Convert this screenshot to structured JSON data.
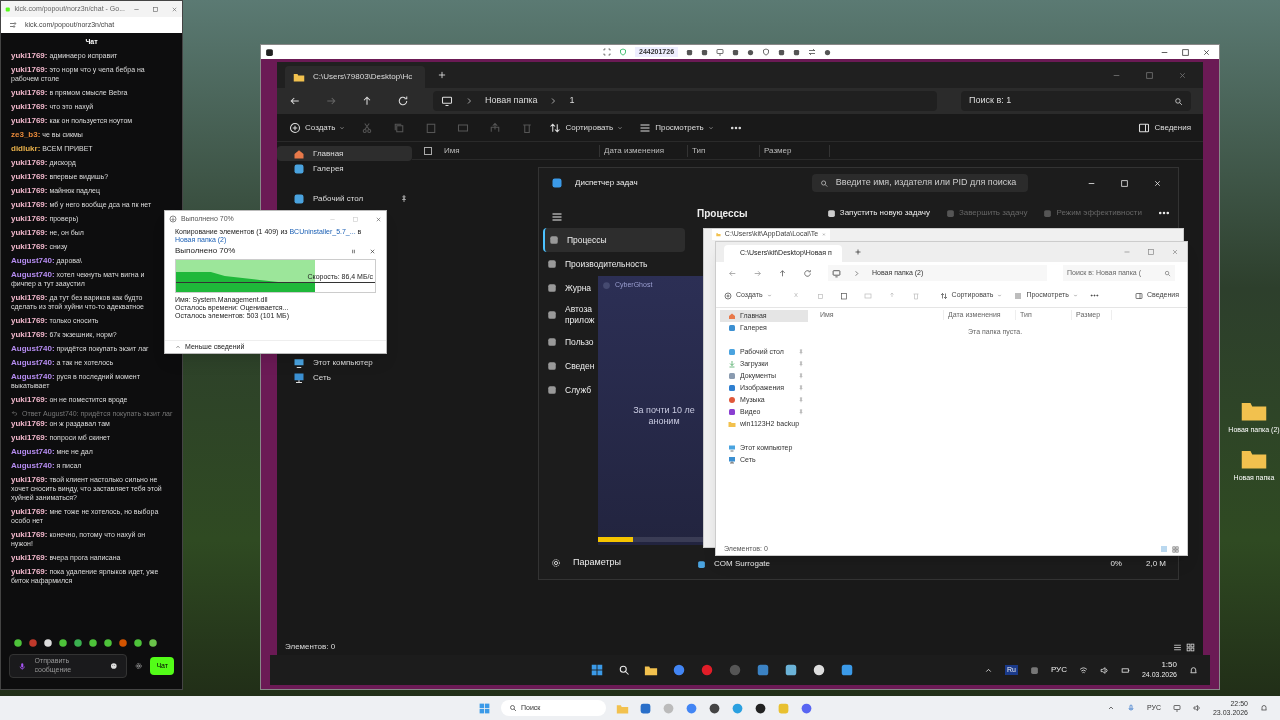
{
  "host_desktop": {
    "icons": [
      {
        "label": "Новая папка (2)"
      },
      {
        "label": "Новая папка"
      }
    ]
  },
  "chat_window": {
    "title": "kick.com/popout/norz3n/chat - Go...",
    "url": "kick.com/popout/norz3n/chat",
    "header": "Чат",
    "messages": [
      {
        "kind": "message",
        "user": "yuki1769:",
        "color": "#f2b8cc",
        "text": "админаеро исправит"
      },
      {
        "kind": "message",
        "user": "yuki1769:",
        "color": "#f2b8cc",
        "text": "это норм что у чела бебра на рабочем столе"
      },
      {
        "kind": "message",
        "user": "yuki1769:",
        "color": "#f2b8cc",
        "text": "в прямом смысле Bebra"
      },
      {
        "kind": "message",
        "user": "yuki1769:",
        "color": "#f2b8cc",
        "text": "что это нахуй"
      },
      {
        "kind": "message",
        "user": "yuki1769:",
        "color": "#f2b8cc",
        "text": "как он пользуется ноутом"
      },
      {
        "kind": "message",
        "user": "ze3_b3:",
        "color": "#e8893a",
        "text": "че вы сикмы"
      },
      {
        "kind": "message",
        "user": "didlukr:",
        "color": "#e8b04a",
        "text": "ВСЕМ ПРИВЕТ"
      },
      {
        "kind": "message",
        "user": "yuki1769:",
        "color": "#f2b8cc",
        "text": "дискорд"
      },
      {
        "kind": "message",
        "user": "yuki1769:",
        "color": "#f2b8cc",
        "text": "впервые видишь?"
      },
      {
        "kind": "message",
        "user": "yuki1769:",
        "color": "#f2b8cc",
        "text": "майнюк падлец"
      },
      {
        "kind": "message",
        "user": "yuki1769:",
        "color": "#f2b8cc",
        "text": "мб у него вообще дса на пк нет"
      },
      {
        "kind": "message",
        "user": "yuki1769:",
        "color": "#f2b8cc",
        "text": "проверь)"
      },
      {
        "kind": "message",
        "user": "yuki1769:",
        "color": "#f2b8cc",
        "text": "не, он был"
      },
      {
        "kind": "message",
        "user": "yuki1769:",
        "color": "#f2b8cc",
        "text": "снизу"
      },
      {
        "kind": "message",
        "user": "August740:",
        "color": "#b58cf0",
        "text": "дарова\\"
      },
      {
        "kind": "message",
        "user": "August740:",
        "color": "#b58cf0",
        "text": "хотел чекнуть матч вигна и фичпер а тут заaустил"
      },
      {
        "kind": "message",
        "user": "yuki1769:",
        "color": "#f2b8cc",
        "text": "да тут без вариков как будто сделать из этой хуйни что-то адекватное"
      },
      {
        "kind": "message",
        "user": "yuki1769:",
        "color": "#f2b8cc",
        "text": "только сносить"
      },
      {
        "kind": "message",
        "user": "yuki1769:",
        "color": "#f2b8cc",
        "text": "67к экзешник, норм?"
      },
      {
        "kind": "message",
        "user": "August740:",
        "color": "#b58cf0",
        "text": "придётся покупать экзит лаг"
      },
      {
        "kind": "message",
        "user": "August740:",
        "color": "#b58cf0",
        "text": "а так не хотелось"
      },
      {
        "kind": "message",
        "user": "August740:",
        "color": "#b58cf0",
        "text": "руся в последний момент выкатывает"
      },
      {
        "kind": "message",
        "user": "yuki1769:",
        "color": "#f2b8cc",
        "text": "он не поместится вроде"
      },
      {
        "kind": "reply",
        "text": "Ответ August740: придётся покупать экзит лаг"
      },
      {
        "kind": "message",
        "user": "yuki1769:",
        "color": "#f2b8cc",
        "text": "он ж раздавал там"
      },
      {
        "kind": "message",
        "user": "yuki1769:",
        "color": "#f2b8cc",
        "text": "попроси мб скинет"
      },
      {
        "kind": "message",
        "user": "August740:",
        "color": "#b58cf0",
        "text": "мне не дал"
      },
      {
        "kind": "message",
        "user": "August740:",
        "color": "#b58cf0",
        "text": "я писал"
      },
      {
        "kind": "message",
        "user": "yuki1769:",
        "color": "#f2b8cc",
        "text": "твой клиент настолько сильно не хочет сносить винду, что заставляет тебя этой хуйней заниматься?"
      },
      {
        "kind": "message",
        "user": "yuki1769:",
        "color": "#f2b8cc",
        "text": "мне тоже не хотелось, но выбора особо нет"
      },
      {
        "kind": "message",
        "user": "yuki1769:",
        "color": "#f2b8cc",
        "text": "конечно, потому что нахуй он нужон!"
      },
      {
        "kind": "message",
        "user": "yuki1769:",
        "color": "#f2b8cc",
        "text": "вчера прога написана"
      },
      {
        "kind": "message",
        "user": "yuki1769:",
        "color": "#f2b8cc",
        "text": "пока удаление ярлыков идет, уже биток нафармился"
      }
    ],
    "input": {
      "placeholder": "Отправить сообщение"
    },
    "send_button": "Чат"
  },
  "copy_dialog": {
    "title": "Выполнено 70%",
    "summary": "Копирование элементов (1 409) из",
    "source": "BCUninstaller_5.7_...",
    "joiner": "в",
    "destination": "Новая папка (2)",
    "heading": "Выполнено 70%",
    "level": 0.7,
    "speed": "Скорость: 86,4 МБ/с",
    "details": [
      {
        "label": "Имя:",
        "value": "System.Management.dll"
      },
      {
        "label": "Осталось времени:",
        "value": "Оценивается..."
      },
      {
        "label": "Осталось элементов:",
        "value": "503 (101 МБ)"
      }
    ],
    "toggle": "Меньше сведений"
  },
  "remote_window": {
    "session_id": "244201726"
  },
  "dark_explorer": {
    "tab": "C:\\Users\\79803\\Desktop\\Нс",
    "breadcrumb": [
      "Новая папка",
      "1"
    ],
    "search": "Поиск в: 1",
    "toolbar": {
      "create": "Создать",
      "sort": "Сортировать",
      "view": "Просмотреть",
      "details": "Сведения"
    },
    "nav": [
      {
        "label": "Главная",
        "selected": true
      },
      {
        "label": "Галерея",
        "selected": false
      },
      {
        "label": "Рабочий стол",
        "selected": false
      },
      {
        "label": "Этот компьютер",
        "selected": false
      },
      {
        "label": "Сеть",
        "selected": false
      }
    ],
    "select_all_checked": false,
    "columns": [
      "Имя",
      "Дата изменения",
      "Тип",
      "Размер"
    ],
    "status": "Элементов: 0"
  },
  "task_manager": {
    "title": "Диспетчер задач",
    "search": {
      "placeholder": "Введите имя, издателя или PID для поиска"
    },
    "nav": [
      {
        "label": "Процессы",
        "selected": true
      },
      {
        "label": "Производительность",
        "selected": false
      },
      {
        "label": "Журна",
        "selected": false
      },
      {
        "label": "Автоза прилож",
        "selected": false
      },
      {
        "label": "Пользо",
        "selected": false
      },
      {
        "label": "Сведен",
        "selected": false
      },
      {
        "label": "Служб",
        "selected": false
      }
    ],
    "settings": "Параметры",
    "header": "Процессы",
    "actions": [
      {
        "label": "Запустить новую задачу",
        "disabled": false
      },
      {
        "label": "Завершить задачу",
        "disabled": true
      },
      {
        "label": "Режим эффективности",
        "disabled": true
      }
    ],
    "row": {
      "name": "COM Surrogate",
      "cpu": "0%",
      "memory": "2,0 М"
    }
  },
  "vpn_overlay": {
    "logo": "CyberGhost",
    "text": "За почти 10 ле аноним",
    "level": 0.33
  },
  "light_explorer_back": {
    "tab": "C:\\Users\\kit\\AppData\\Local\\Te"
  },
  "light_explorer": {
    "tab": "C:\\Users\\kit\\Desktop\\Новая п",
    "breadcrumb": [
      "Новая папка (2)"
    ],
    "search": "Поиск в: Новая папка (",
    "toolbar": {
      "create": "Создать",
      "sort": "Сортировать",
      "view": "Просмотреть",
      "details": "Сведения"
    },
    "nav": [
      {
        "label": "Главная",
        "selected": true,
        "pinned": false
      },
      {
        "label": "Галерея",
        "selected": false,
        "pinned": false
      },
      {
        "label": "Рабочий стол",
        "selected": false,
        "pinned": true
      },
      {
        "label": "Загрузки",
        "selected": false,
        "pinned": true
      },
      {
        "label": "Документы",
        "selected": false,
        "pinned": true
      },
      {
        "label": "Изображения",
        "selected": false,
        "pinned": true
      },
      {
        "label": "Музыка",
        "selected": false,
        "pinned": true
      },
      {
        "label": "Видео",
        "selected": false,
        "pinned": true
      },
      {
        "label": "win1123H2 backup",
        "selected": false,
        "pinned": false
      },
      {
        "label": "Этот компьютер",
        "selected": false,
        "pinned": false
      },
      {
        "label": "Сеть",
        "selected": false,
        "pinned": false
      }
    ],
    "columns": [
      "Имя",
      "Дата изменения",
      "Тип",
      "Размер"
    ],
    "empty": "Эта папка пуста.",
    "status": "Элементов: 0"
  },
  "remote_taskbar": {
    "ime": "Ru",
    "lang": "РУС",
    "time": "1:50",
    "date": "24.03.2026"
  },
  "host_taskbar": {
    "search": "Поиск",
    "lang": "РУС",
    "time": "22:50",
    "date": "23.03.2026"
  }
}
